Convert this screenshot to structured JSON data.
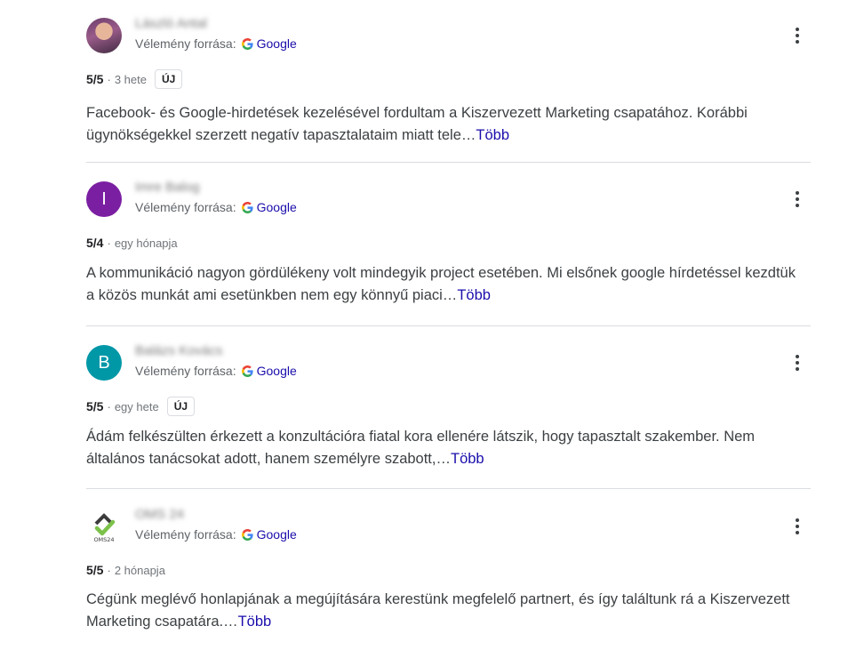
{
  "source_label": "Vélemény forrása:",
  "source_name": "Google",
  "more_label": "Több",
  "reviews": [
    {
      "author": "László Antal",
      "avatar_type": "photo",
      "rating": "5/5",
      "sep": "·",
      "time": "3 hete",
      "badge": "ÚJ",
      "text": "Facebook- és Google-hirdetések kezelésével fordultam a Kiszervezett Marketing csapatához. Korábbi ügynökségekkel szerzett negatív tapasztalataim miatt tele…"
    },
    {
      "author": "Imre Balog",
      "avatar_letter": "I",
      "avatar_color": "#7b1fa2",
      "rating": "5/4",
      "sep": "·",
      "time": "egy hónapja",
      "badge": "",
      "text": "A kommunikáció nagyon gördülékeny volt mindegyik project esetében. Mi elsőnek google hírdetéssel kezdtük a közös munkát ami esetünkben nem egy könnyű piaci…"
    },
    {
      "author": "Balázs Kovács",
      "avatar_letter": "B",
      "avatar_color": "#0097a7",
      "rating": "5/5",
      "sep": "·",
      "time": "egy hete",
      "badge": "ÚJ",
      "text": "Ádám felkészülten érkezett a konzultációra fiatal kora ellenére látszik, hogy tapasztalt szakember. Nem általános tanácsokat adott, hanem személyre szabott,…"
    },
    {
      "author": "OMS 24",
      "avatar_type": "logo",
      "logo_text": "OMS24",
      "rating": "5/5",
      "sep": "·",
      "time": "2 hónapja",
      "badge": "",
      "text": "Cégünk meglévő honlapjának a megújítására kerestünk megfelelő partnert, és így találtunk rá a Kiszervezett Marketing csapatára.…"
    }
  ],
  "colors": {
    "link": "#1a0dab",
    "divider": "#dadce0",
    "google_blue": "#4285F4",
    "google_red": "#EA4335",
    "google_yellow": "#FBBC05",
    "google_green": "#34A853",
    "oms_green": "#7cc24a",
    "oms_dark": "#3c3c3c"
  }
}
